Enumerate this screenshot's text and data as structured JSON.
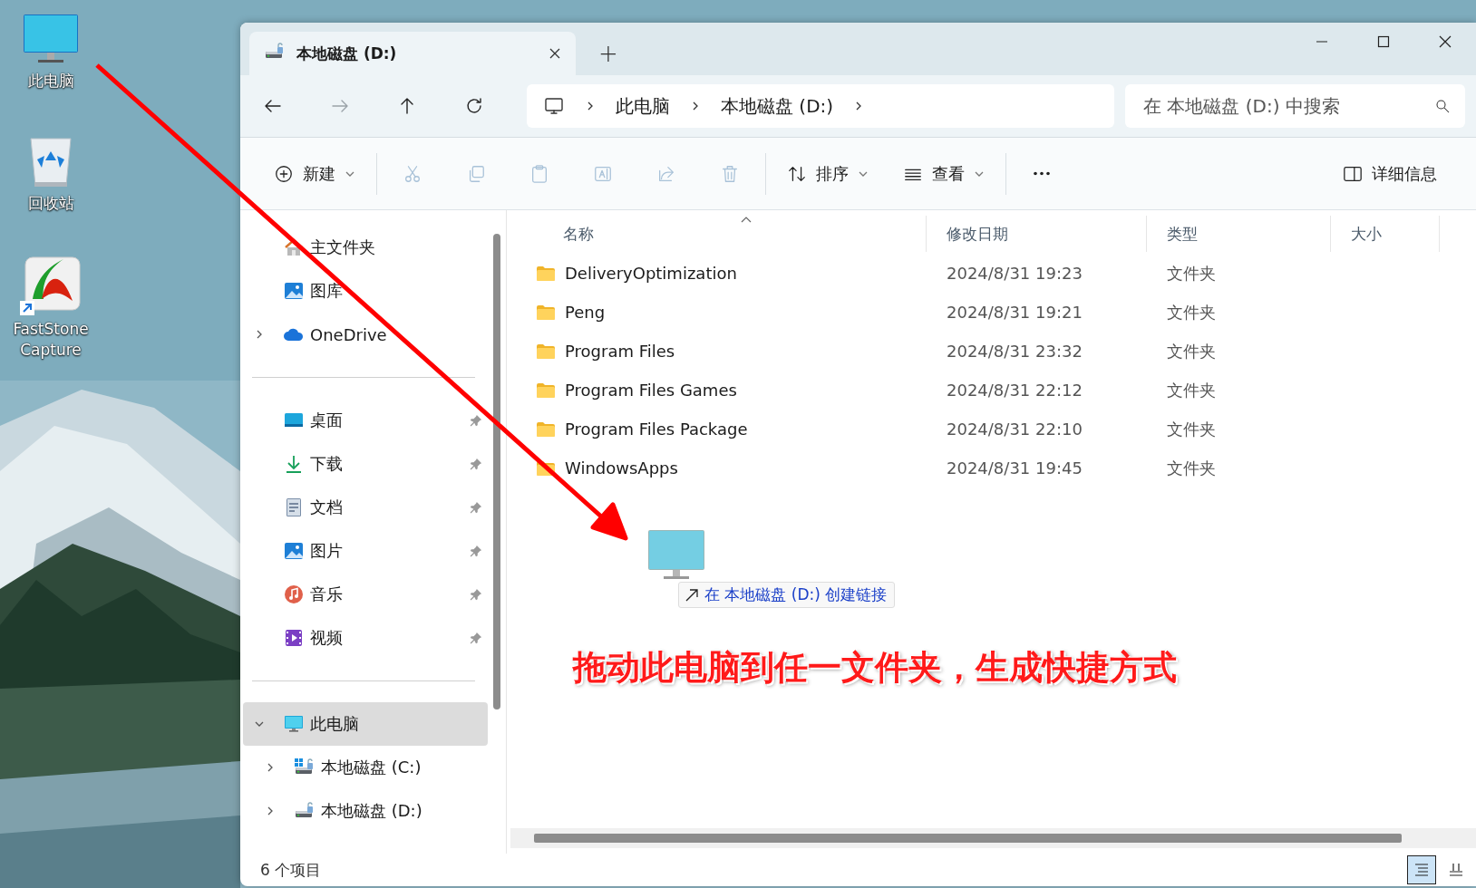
{
  "desktop": {
    "icons": [
      {
        "kind": "computer",
        "label": "此电脑",
        "shortcut": false
      },
      {
        "kind": "recycle",
        "label": "回收站",
        "shortcut": false
      },
      {
        "kind": "app",
        "label": "FastStone Capture",
        "shortcut": true
      }
    ]
  },
  "window": {
    "tabs": [
      {
        "title": "本地磁盘 (D:)",
        "selected": true
      }
    ],
    "new_tab": "+",
    "nav_buttons": [
      {
        "kind": "back",
        "disabled": false
      },
      {
        "kind": "forward",
        "disabled": true
      },
      {
        "kind": "up",
        "disabled": false
      },
      {
        "kind": "refresh",
        "disabled": false
      }
    ],
    "breadcrumbs": [
      "此电脑",
      "本地磁盘 (D:)"
    ],
    "search": {
      "placeholder": "在 本地磁盘 (D:) 中搜索"
    },
    "toolbar": [
      {
        "kind": "new",
        "label": "新建",
        "dropdown": true,
        "disabled": false
      },
      {
        "kind": "divider"
      },
      {
        "kind": "cut",
        "disabled": true
      },
      {
        "kind": "copy",
        "disabled": true
      },
      {
        "kind": "paste",
        "disabled": true
      },
      {
        "kind": "rename",
        "disabled": true
      },
      {
        "kind": "share",
        "disabled": true
      },
      {
        "kind": "delete",
        "disabled": true
      },
      {
        "kind": "divider"
      },
      {
        "kind": "sort",
        "label": "排序",
        "dropdown": true,
        "disabled": false
      },
      {
        "kind": "view",
        "label": "查看",
        "dropdown": true,
        "disabled": false
      },
      {
        "kind": "divider"
      },
      {
        "kind": "more",
        "disabled": false
      },
      {
        "kind": "spacer"
      },
      {
        "kind": "details",
        "label": "详细信息",
        "dropdown": false,
        "disabled": false
      }
    ],
    "sidebar": {
      "groups": [
        {
          "items": [
            {
              "label": "主文件夹",
              "kind": "home",
              "selected": false,
              "pinned": false
            },
            {
              "label": "图库",
              "kind": "gallery",
              "selected": false,
              "pinned": false
            },
            {
              "label": "OneDrive",
              "kind": "cloud",
              "selected": false,
              "pinned": false,
              "expanded": false
            }
          ]
        },
        {
          "items": [
            {
              "label": "桌面",
              "kind": "desktop",
              "selected": false,
              "pinned": true
            },
            {
              "label": "下载",
              "kind": "download",
              "selected": false,
              "pinned": true
            },
            {
              "label": "文档",
              "kind": "document",
              "selected": false,
              "pinned": true
            },
            {
              "label": "图片",
              "kind": "gallery",
              "selected": false,
              "pinned": true
            },
            {
              "label": "音乐",
              "kind": "music",
              "selected": false,
              "pinned": true
            },
            {
              "label": "视频",
              "kind": "video",
              "selected": false,
              "pinned": true
            }
          ]
        },
        {
          "items": [
            {
              "label": "此电脑",
              "kind": "computer",
              "selected": true,
              "pinned": false,
              "expanded": true,
              "children": [
                {
                  "label": "本地磁盘 (C:)",
                  "kind": "system_drive",
                  "selected": false,
                  "pinned": false,
                  "expanded": false
                },
                {
                  "label": "本地磁盘 (D:)",
                  "kind": "drive",
                  "selected": false,
                  "pinned": false,
                  "expanded": false
                }
              ]
            }
          ]
        }
      ]
    },
    "table": {
      "columns": [
        {
          "label": "名称",
          "sorted": true
        },
        {
          "label": "修改日期",
          "sorted": false
        },
        {
          "label": "类型",
          "sorted": false
        },
        {
          "label": "大小",
          "sorted": false
        }
      ],
      "rows": [
        {
          "name": "DeliveryOptimization",
          "modified": "2024/8/31 19:23",
          "type": "文件夹"
        },
        {
          "name": "Peng",
          "modified": "2024/8/31 19:21",
          "type": "文件夹"
        },
        {
          "name": "Program Files",
          "modified": "2024/8/31 23:32",
          "type": "文件夹"
        },
        {
          "name": "Program Files Games",
          "modified": "2024/8/31 22:12",
          "type": "文件夹"
        },
        {
          "name": "Program Files Package",
          "modified": "2024/8/31 22:10",
          "type": "文件夹"
        },
        {
          "name": "WindowsApps",
          "modified": "2024/8/31 19:45",
          "type": "文件夹"
        }
      ]
    },
    "drag": {
      "tooltip": "在 本地磁盘 (D:) 创建链接"
    },
    "status_bar": {
      "item_count": "6 个项目",
      "views": [
        {
          "kind": "details",
          "selected": true
        },
        {
          "kind": "tiles",
          "selected": false
        }
      ]
    }
  },
  "annotation": {
    "text": "拖动此电脑到任一文件夹，生成快捷方式"
  }
}
